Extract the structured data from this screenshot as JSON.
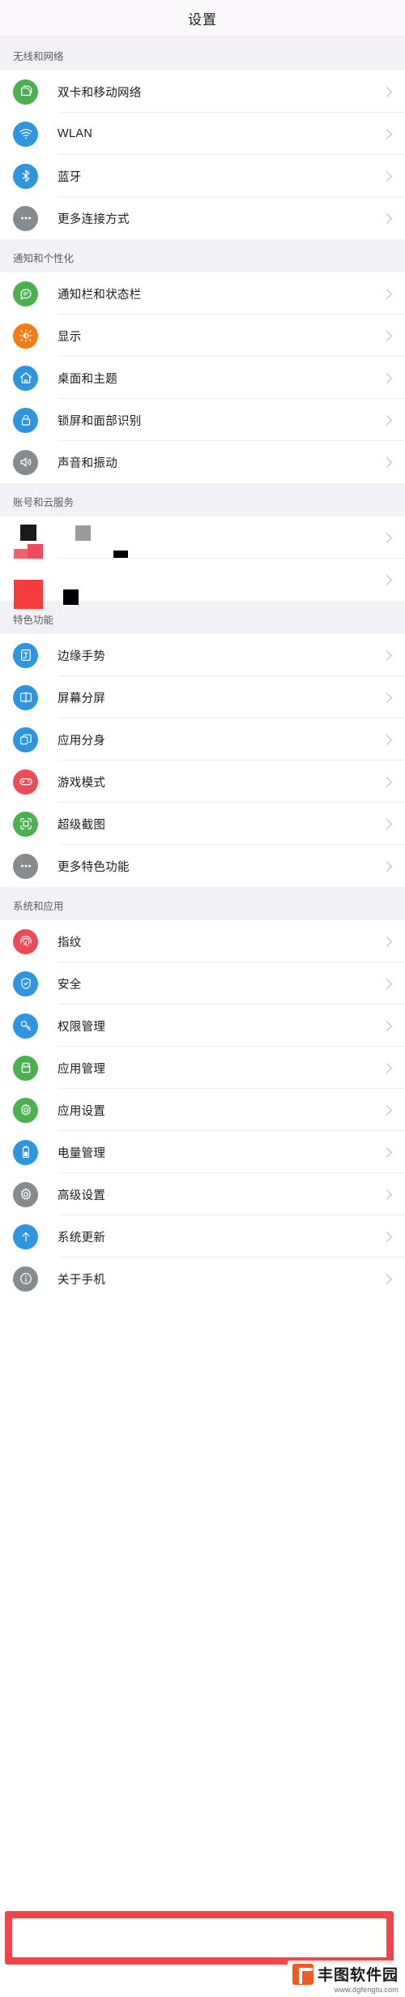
{
  "header": {
    "title": "设置"
  },
  "watermark": {
    "name": "丰图软件园",
    "url": "www.dgfengtu.com"
  },
  "colors": {
    "green": "#4cb050",
    "blue": "#2f95e0",
    "gray": "#868b8f",
    "orange": "#f57b14",
    "red": "#ec4c58",
    "annotation": "#f2454b"
  },
  "sections": [
    {
      "title": "无线和网络",
      "items": [
        {
          "label": "双卡和移动网络",
          "icon": "sim-card-icon",
          "color": "#4cb050"
        },
        {
          "label": "WLAN",
          "icon": "wifi-icon",
          "color": "#2f95e0"
        },
        {
          "label": "蓝牙",
          "icon": "bluetooth-icon",
          "color": "#2f95e0"
        },
        {
          "label": "更多连接方式",
          "icon": "ellipsis-icon",
          "color": "#868b8f"
        }
      ]
    },
    {
      "title": "通知和个性化",
      "items": [
        {
          "label": "通知栏和状态栏",
          "icon": "chat-bubble-icon",
          "color": "#4cb050"
        },
        {
          "label": "显示",
          "icon": "brightness-icon",
          "color": "#f57b14"
        },
        {
          "label": "桌面和主题",
          "icon": "home-icon",
          "color": "#2f95e0"
        },
        {
          "label": "锁屏和面部识别",
          "icon": "lock-icon",
          "color": "#2f95e0"
        },
        {
          "label": "声音和振动",
          "icon": "speaker-icon",
          "color": "#868b8f"
        }
      ]
    },
    {
      "title": "账号和云服务",
      "redacted": true,
      "items": [
        {
          "label": "",
          "icon": "redacted-icon",
          "color": "#ffffff"
        },
        {
          "label": "",
          "icon": "redacted-icon",
          "color": "#ffffff"
        }
      ]
    },
    {
      "title": "特色功能",
      "items": [
        {
          "label": "边缘手势",
          "icon": "edge-gesture-icon",
          "color": "#2f95e0"
        },
        {
          "label": "屏幕分屏",
          "icon": "split-screen-icon",
          "color": "#2f95e0"
        },
        {
          "label": "应用分身",
          "icon": "app-clone-icon",
          "color": "#2f95e0"
        },
        {
          "label": "游戏模式",
          "icon": "gamepad-icon",
          "color": "#ec4c58"
        },
        {
          "label": "超级截图",
          "icon": "screenshot-icon",
          "color": "#4cb050"
        },
        {
          "label": "更多特色功能",
          "icon": "ellipsis-icon",
          "color": "#868b8f"
        }
      ]
    },
    {
      "title": "系统和应用",
      "items": [
        {
          "label": "指纹",
          "icon": "fingerprint-icon",
          "color": "#ec4c58"
        },
        {
          "label": "安全",
          "icon": "shield-icon",
          "color": "#2f95e0"
        },
        {
          "label": "权限管理",
          "icon": "key-icon",
          "color": "#2f95e0"
        },
        {
          "label": "应用管理",
          "icon": "android-icon",
          "color": "#4cb050"
        },
        {
          "label": "应用设置",
          "icon": "gear-icon",
          "color": "#4cb050"
        },
        {
          "label": "电量管理",
          "icon": "battery-icon",
          "color": "#2f95e0"
        },
        {
          "label": "高级设置",
          "icon": "gear-icon",
          "color": "#868b8f"
        },
        {
          "label": "系统更新",
          "icon": "upload-arrow-icon",
          "color": "#2f95e0"
        },
        {
          "label": "关于手机",
          "icon": "info-icon",
          "color": "#868b8f",
          "highlighted": true
        }
      ]
    }
  ]
}
